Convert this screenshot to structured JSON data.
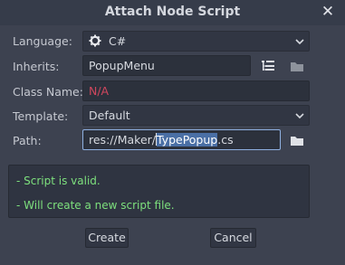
{
  "dialog": {
    "title": "Attach Node Script",
    "close_glyph": "✕"
  },
  "form": {
    "language": {
      "label": "Language:",
      "value": "C#",
      "icon": "csharp-gear-icon"
    },
    "inherits": {
      "label": "Inherits:",
      "value": "PopupMenu"
    },
    "class_name": {
      "label": "Class Name:",
      "value": "N/A"
    },
    "template": {
      "label": "Template:",
      "value": "Default"
    },
    "path": {
      "label": "Path:",
      "value_prefix": "res://Maker/",
      "value_selected": "TypePopup",
      "value_suffix": ".cs"
    }
  },
  "status": {
    "line1": "- Script is valid.",
    "line2": "- Will create a new script file."
  },
  "buttons": {
    "create": "Create",
    "cancel": "Cancel"
  },
  "colors": {
    "background": "#3d4250",
    "field_bg": "#2c313c",
    "valid_text": "#7de07d",
    "na_text": "#d0475e",
    "selection": "#4a6fa5"
  }
}
